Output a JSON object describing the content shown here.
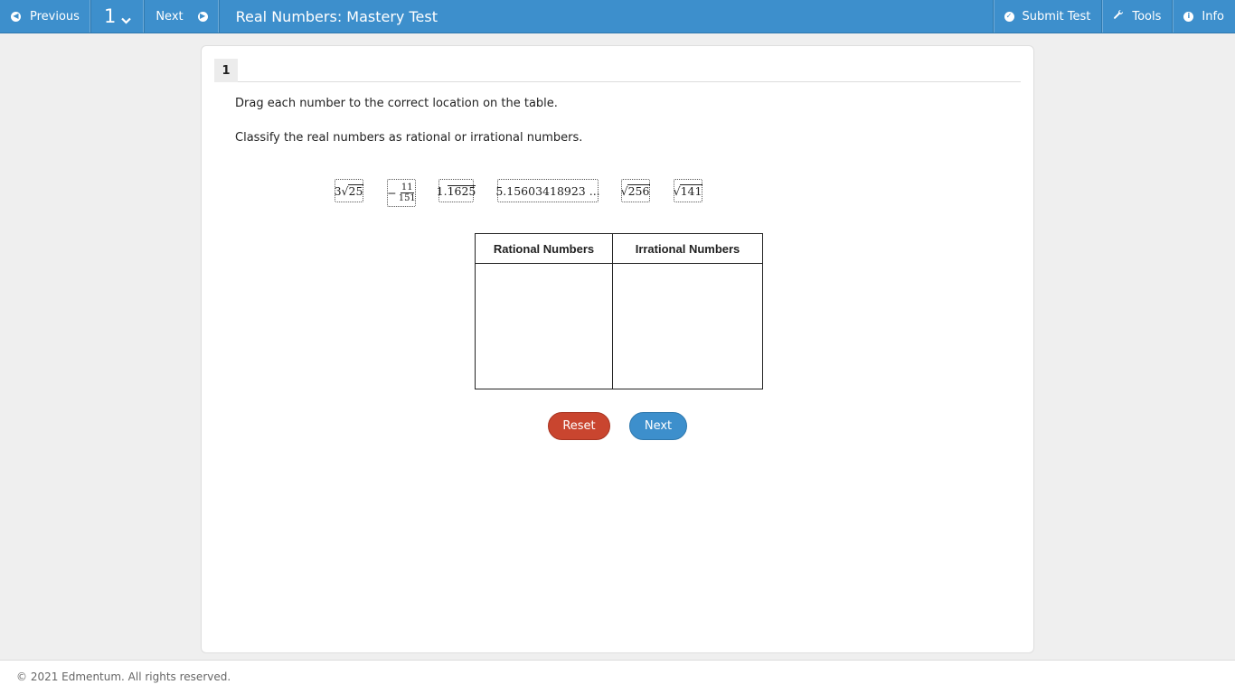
{
  "topbar": {
    "previous_label": "Previous",
    "question_number": "1",
    "next_label": "Next",
    "title": "Real Numbers: Mastery Test",
    "submit_label": "Submit Test",
    "tools_label": "Tools",
    "info_label": "Info",
    "bg_color": "#3d8fcc"
  },
  "question": {
    "tab_label": "1",
    "instruction_1": "Drag each number to the correct location on the table.",
    "instruction_2": "Classify the real numbers as rational or irrational numbers."
  },
  "tiles": {
    "t1": {
      "coef": "3",
      "radicand": "25"
    },
    "t2": {
      "sign": "−",
      "numerator": "11",
      "denominator": "151"
    },
    "t3": {
      "whole": "1.",
      "repeating": "1625"
    },
    "t4": {
      "text": "5.15603418923 ..."
    },
    "t5": {
      "radicand": "256"
    },
    "t6": {
      "radicand": "141"
    }
  },
  "table": {
    "col1": "Rational Numbers",
    "col2": "Irrational Numbers"
  },
  "actions": {
    "reset_label": "Reset",
    "next_label": "Next"
  },
  "footer": {
    "copyright": "© 2021 Edmentum. All rights reserved."
  }
}
